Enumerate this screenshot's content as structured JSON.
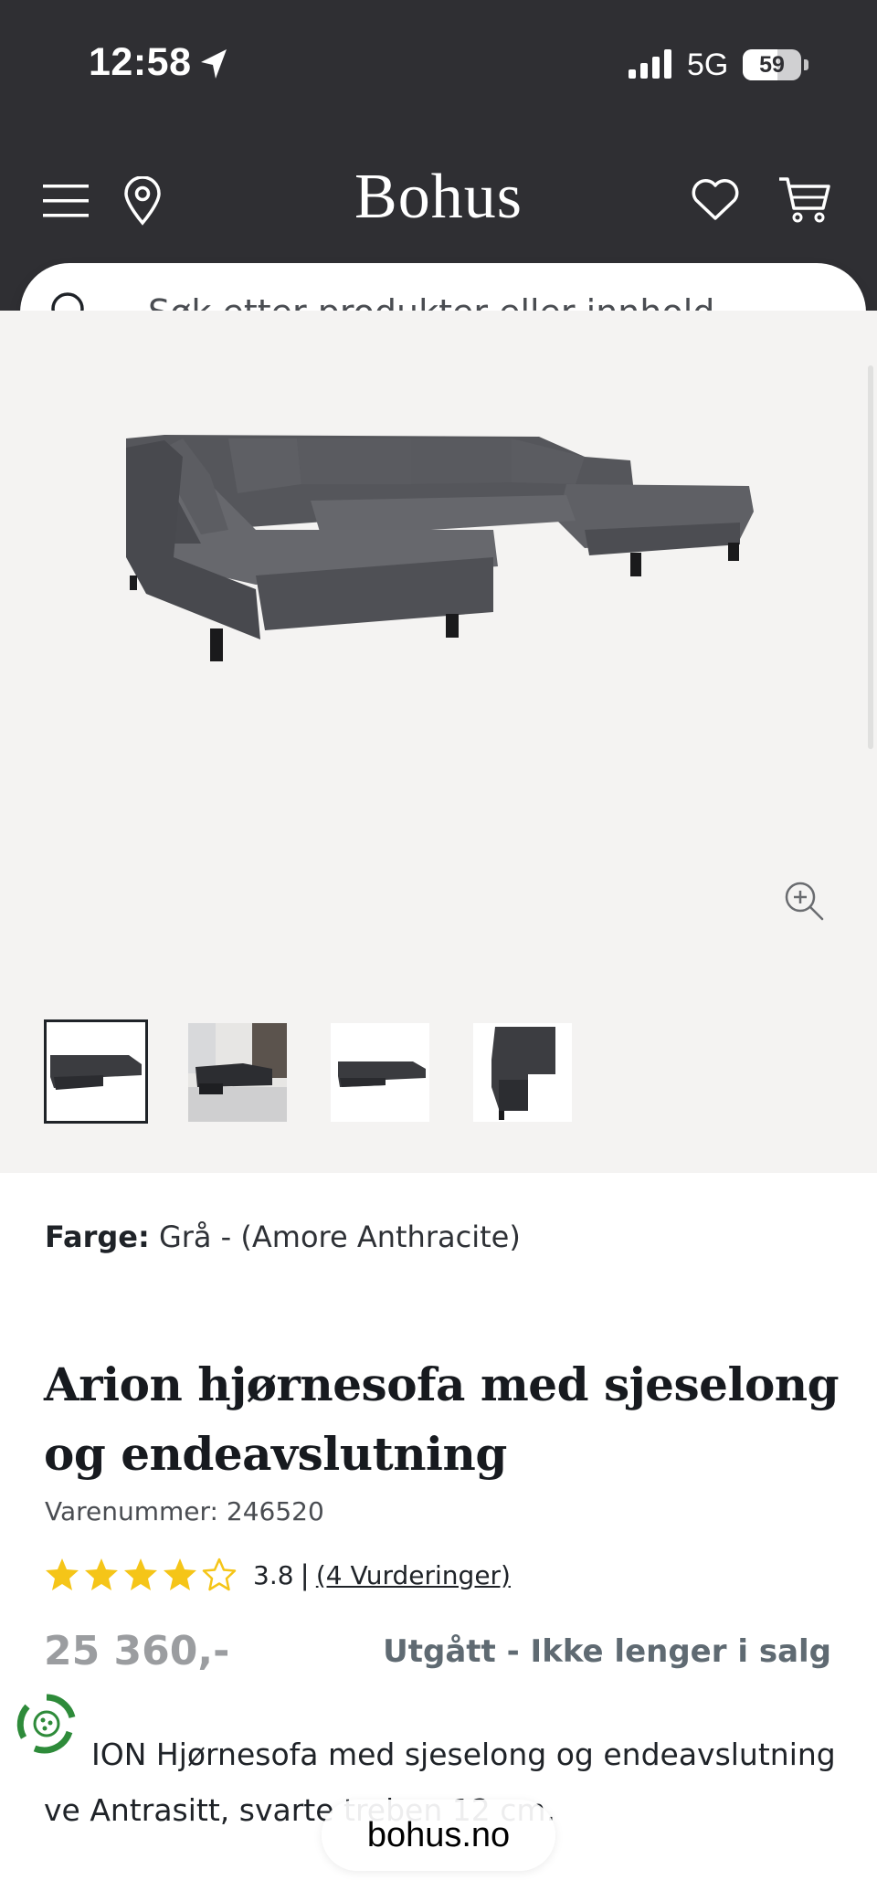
{
  "status_bar": {
    "time": "12:58",
    "network": "5G",
    "battery_percent": 59,
    "battery_label": "59"
  },
  "header": {
    "brand": "Bohus",
    "search_placeholder": "Søk etter produkter eller innhold ..."
  },
  "gallery": {
    "thumbnails": [
      "thumbnail-1",
      "thumbnail-2",
      "thumbnail-3",
      "thumbnail-4"
    ],
    "selected_index": 0
  },
  "product": {
    "color_label": "Farge:",
    "color_value": "Grå - (Amore Anthracite)",
    "title": "Arion hjørnesofa med sjeselong og endeavslutning",
    "sku": "Varenummer: 246520",
    "rating": 3.8,
    "rating_text": "3.8",
    "rating_separator": "|",
    "reviews_link": "(4 Vurderinger)",
    "price": "25 360,-",
    "availability": "Utgått - Ikke lenger i salg",
    "description": "ION Hjørnesofa med sjeselong og endeavslutning ve                            Antrasitt, svarte treben 12 cm."
  },
  "browser": {
    "domain": "bohus.no"
  },
  "colors": {
    "header_bg": "#2f2f33",
    "gallery_bg": "#f4f3f2",
    "star": "#f5c518",
    "price_muted": "#9b9da0",
    "availability": "#5f6a72",
    "eco_green": "#2e8b3a"
  },
  "icons": [
    "location-arrow-icon",
    "signal-icon",
    "battery-icon",
    "menu-icon",
    "map-pin-icon",
    "heart-icon",
    "cart-icon",
    "search-icon",
    "zoom-in-icon",
    "star-icon",
    "recycle-badge-icon"
  ]
}
